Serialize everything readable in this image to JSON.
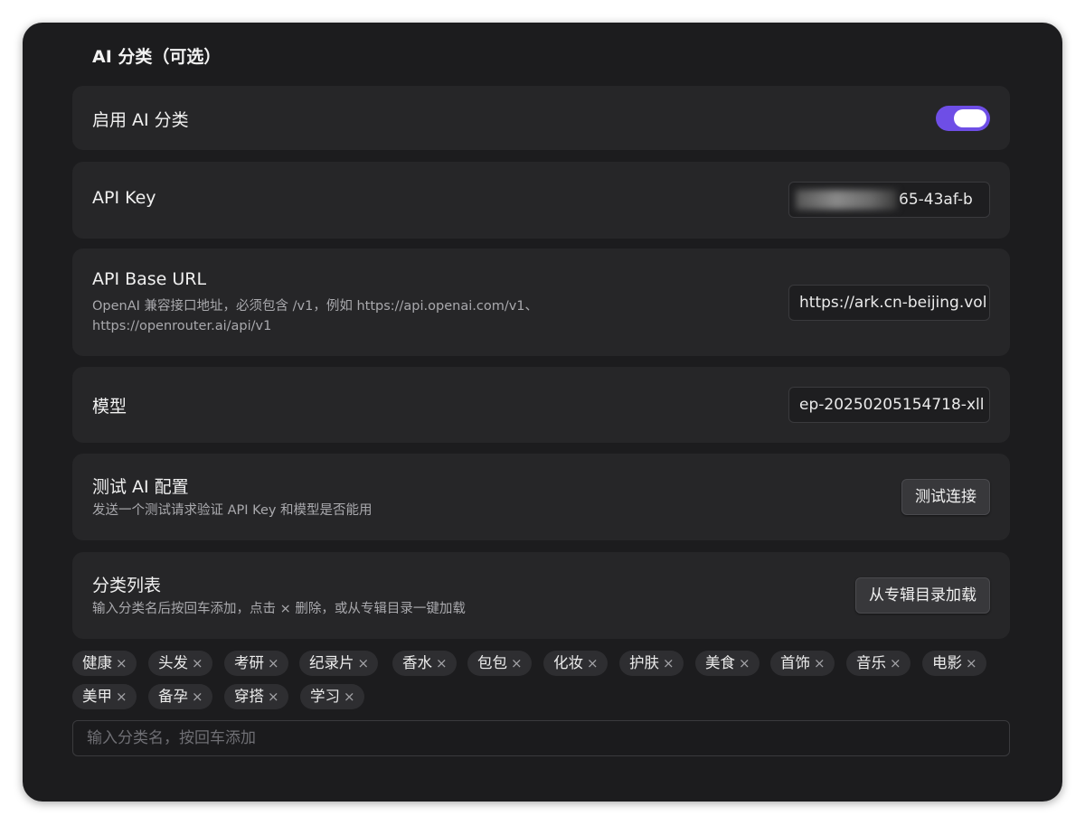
{
  "section": {
    "title": "AI 分类（可选）"
  },
  "enable_ai": {
    "label": "启用 AI 分类",
    "enabled": true
  },
  "api_key": {
    "label": "API Key",
    "visible_suffix": "65-43af-b"
  },
  "base_url": {
    "label": "API Base URL",
    "description": "OpenAI 兼容接口地址，必须包含 /v1，例如 https://api.openai.com/v1、https://openrouter.ai/api/v1",
    "value": "https://ark.cn-beijing.vol"
  },
  "model": {
    "label": "模型",
    "value": "ep-20250205154718-xll"
  },
  "test_ai": {
    "label": "测试 AI 配置",
    "description": "发送一个测试请求验证 API Key 和模型是否能用",
    "button": "测试连接"
  },
  "category_list": {
    "label": "分类列表",
    "description": "输入分类名后按回车添加，点击 × 删除，或从专辑目录一键加载",
    "button": "从专辑目录加载"
  },
  "tags": [
    "健康",
    "头发",
    "考研",
    "纪录片",
    "香水",
    "包包",
    "化妆",
    "护肤",
    "美食",
    "首饰",
    "音乐",
    "电影",
    "美甲",
    "备孕",
    "穿搭",
    "学习"
  ],
  "tag_remove_glyph": "×",
  "add_input": {
    "placeholder": "输入分类名，按回车添加"
  },
  "colors": {
    "accent": "#6e4ee6",
    "background": "#1c1c1e",
    "card": "#262628"
  }
}
